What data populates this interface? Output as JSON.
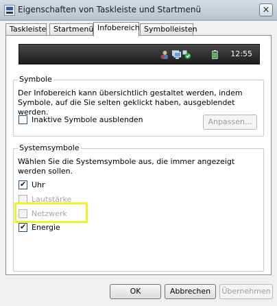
{
  "window": {
    "title": "Eigenschaften von Taskleiste und Startmenü",
    "close_label": "×"
  },
  "tabs": [
    {
      "label": "Taskleiste"
    },
    {
      "label": "Startmenü"
    },
    {
      "label": "Infobereich"
    },
    {
      "label": "Symbolleisten"
    }
  ],
  "taskbar_preview": {
    "clock": "12:55"
  },
  "symbole": {
    "title": "Symbole",
    "description": "Der Infobereich kann übersichtlich gestaltet werden, indem Symbole, auf die Sie selten geklickt haben, ausgeblendet werden.",
    "hide_inactive_label": "Inaktive Symbole ausblenden",
    "hide_inactive_checked": false,
    "customize_label": "Anpassen..."
  },
  "systemsymbole": {
    "title": "Systemsymbole",
    "description": "Wählen Sie die Systemsymbole aus, die immer angezeigt werden sollen.",
    "items": [
      {
        "label": "Uhr",
        "checked": true,
        "enabled": true
      },
      {
        "label": "Lautstärke",
        "checked": false,
        "enabled": false
      },
      {
        "label": "Netzwerk",
        "checked": false,
        "enabled": false
      },
      {
        "label": "Energie",
        "checked": true,
        "enabled": true
      }
    ]
  },
  "buttons": {
    "ok": "OK",
    "cancel": "Abbrechen",
    "apply": "Übernehmen"
  },
  "colors": {
    "highlight": "#f1f12a",
    "taskbar": "#2a2a2a"
  }
}
